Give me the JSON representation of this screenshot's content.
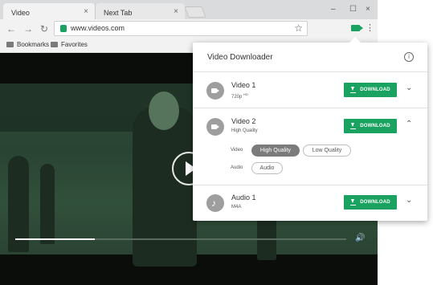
{
  "tabs": [
    {
      "label": "Video",
      "close": "×"
    },
    {
      "label": "Next Tab",
      "close": "×"
    }
  ],
  "window_controls": [
    "–",
    "☐",
    "×"
  ],
  "address_bar": {
    "url": "www.videos.com"
  },
  "bookmarks": [
    "Bookmarks",
    "Favorites"
  ],
  "video": {
    "progress": 0.24
  },
  "popup": {
    "title": "Video Downloader",
    "download_label": "DOWNLOAD",
    "items": [
      {
        "title": "Video 1",
        "subtitle": "720p",
        "subtitle_badge": "HD",
        "icon": "video-camera-icon",
        "expanded": false
      },
      {
        "title": "Video 2",
        "subtitle": "High Quality",
        "icon": "video-camera-icon",
        "expanded": true
      },
      {
        "title": "Audio 1",
        "subtitle": "M4A",
        "icon": "music-note-icon",
        "expanded": false
      }
    ],
    "options": {
      "video_label": "Video",
      "video_choices": [
        "High Quality",
        "Low Quality"
      ],
      "video_selected": "High Quality",
      "audio_label": "Audio",
      "audio_choices": [
        "Audio"
      ]
    }
  },
  "colors": {
    "accent": "#1aa260",
    "selected_chip": "#7b7b7b"
  }
}
